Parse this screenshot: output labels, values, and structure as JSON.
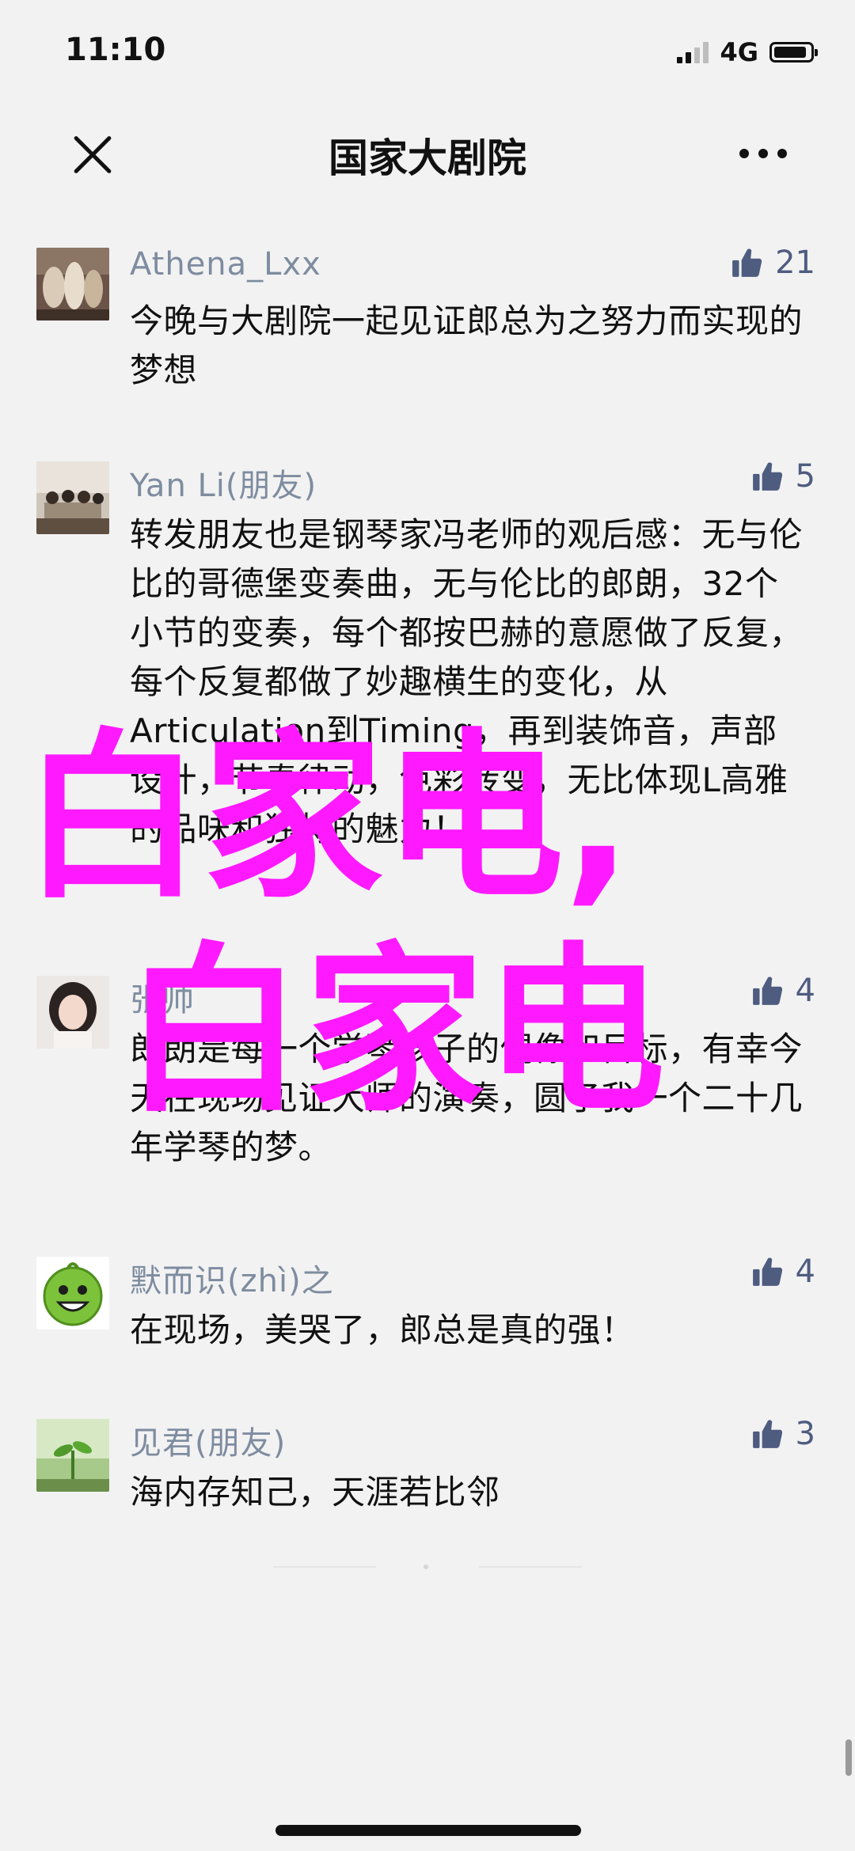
{
  "status_bar": {
    "time": "11:10",
    "network": "4G",
    "battery_level": 0.9
  },
  "nav": {
    "title": "国家大剧院"
  },
  "comments": [
    {
      "author": "Athena_Lxx",
      "likes": "21",
      "text": "今晚与大剧院一起见证郎总为之努力而实现的梦想"
    },
    {
      "author": "Yan Li(朋友)",
      "likes": "5",
      "text": "转发朋友也是钢琴家冯老师的观后感：无与伦比的哥德堡变奏曲，无与伦比的郎朗，32个小节的变奏，每个都按巴赫的意愿做了反复，每个反复都做了妙趣横生的变化，从Articulation到Timing，再到装饰音，声部设计，节奏律动，色彩转变，无比体现L高雅的品味和独特的魅力！"
    },
    {
      "author": "张帅",
      "likes": "4",
      "text": "郎朗是每一个学琴孩子的偶像和目标，有幸今天在现场见证大师的演奏，圆了我一个二十几年学琴的梦。"
    },
    {
      "author": "默而识(zhì)之",
      "likes": "4",
      "text": "在现场，美哭了，郎总是真的强！"
    },
    {
      "author": "见君(朋友)",
      "likes": "3",
      "text": "海内存知己，天涯若比邻"
    }
  ],
  "watermark": {
    "line1": "白家电,",
    "line2": "白家电"
  },
  "colors": {
    "background": "#f2f2f2",
    "author": "#7e8ca0",
    "like": "#4e5c80",
    "watermark": "#ff19ff"
  }
}
